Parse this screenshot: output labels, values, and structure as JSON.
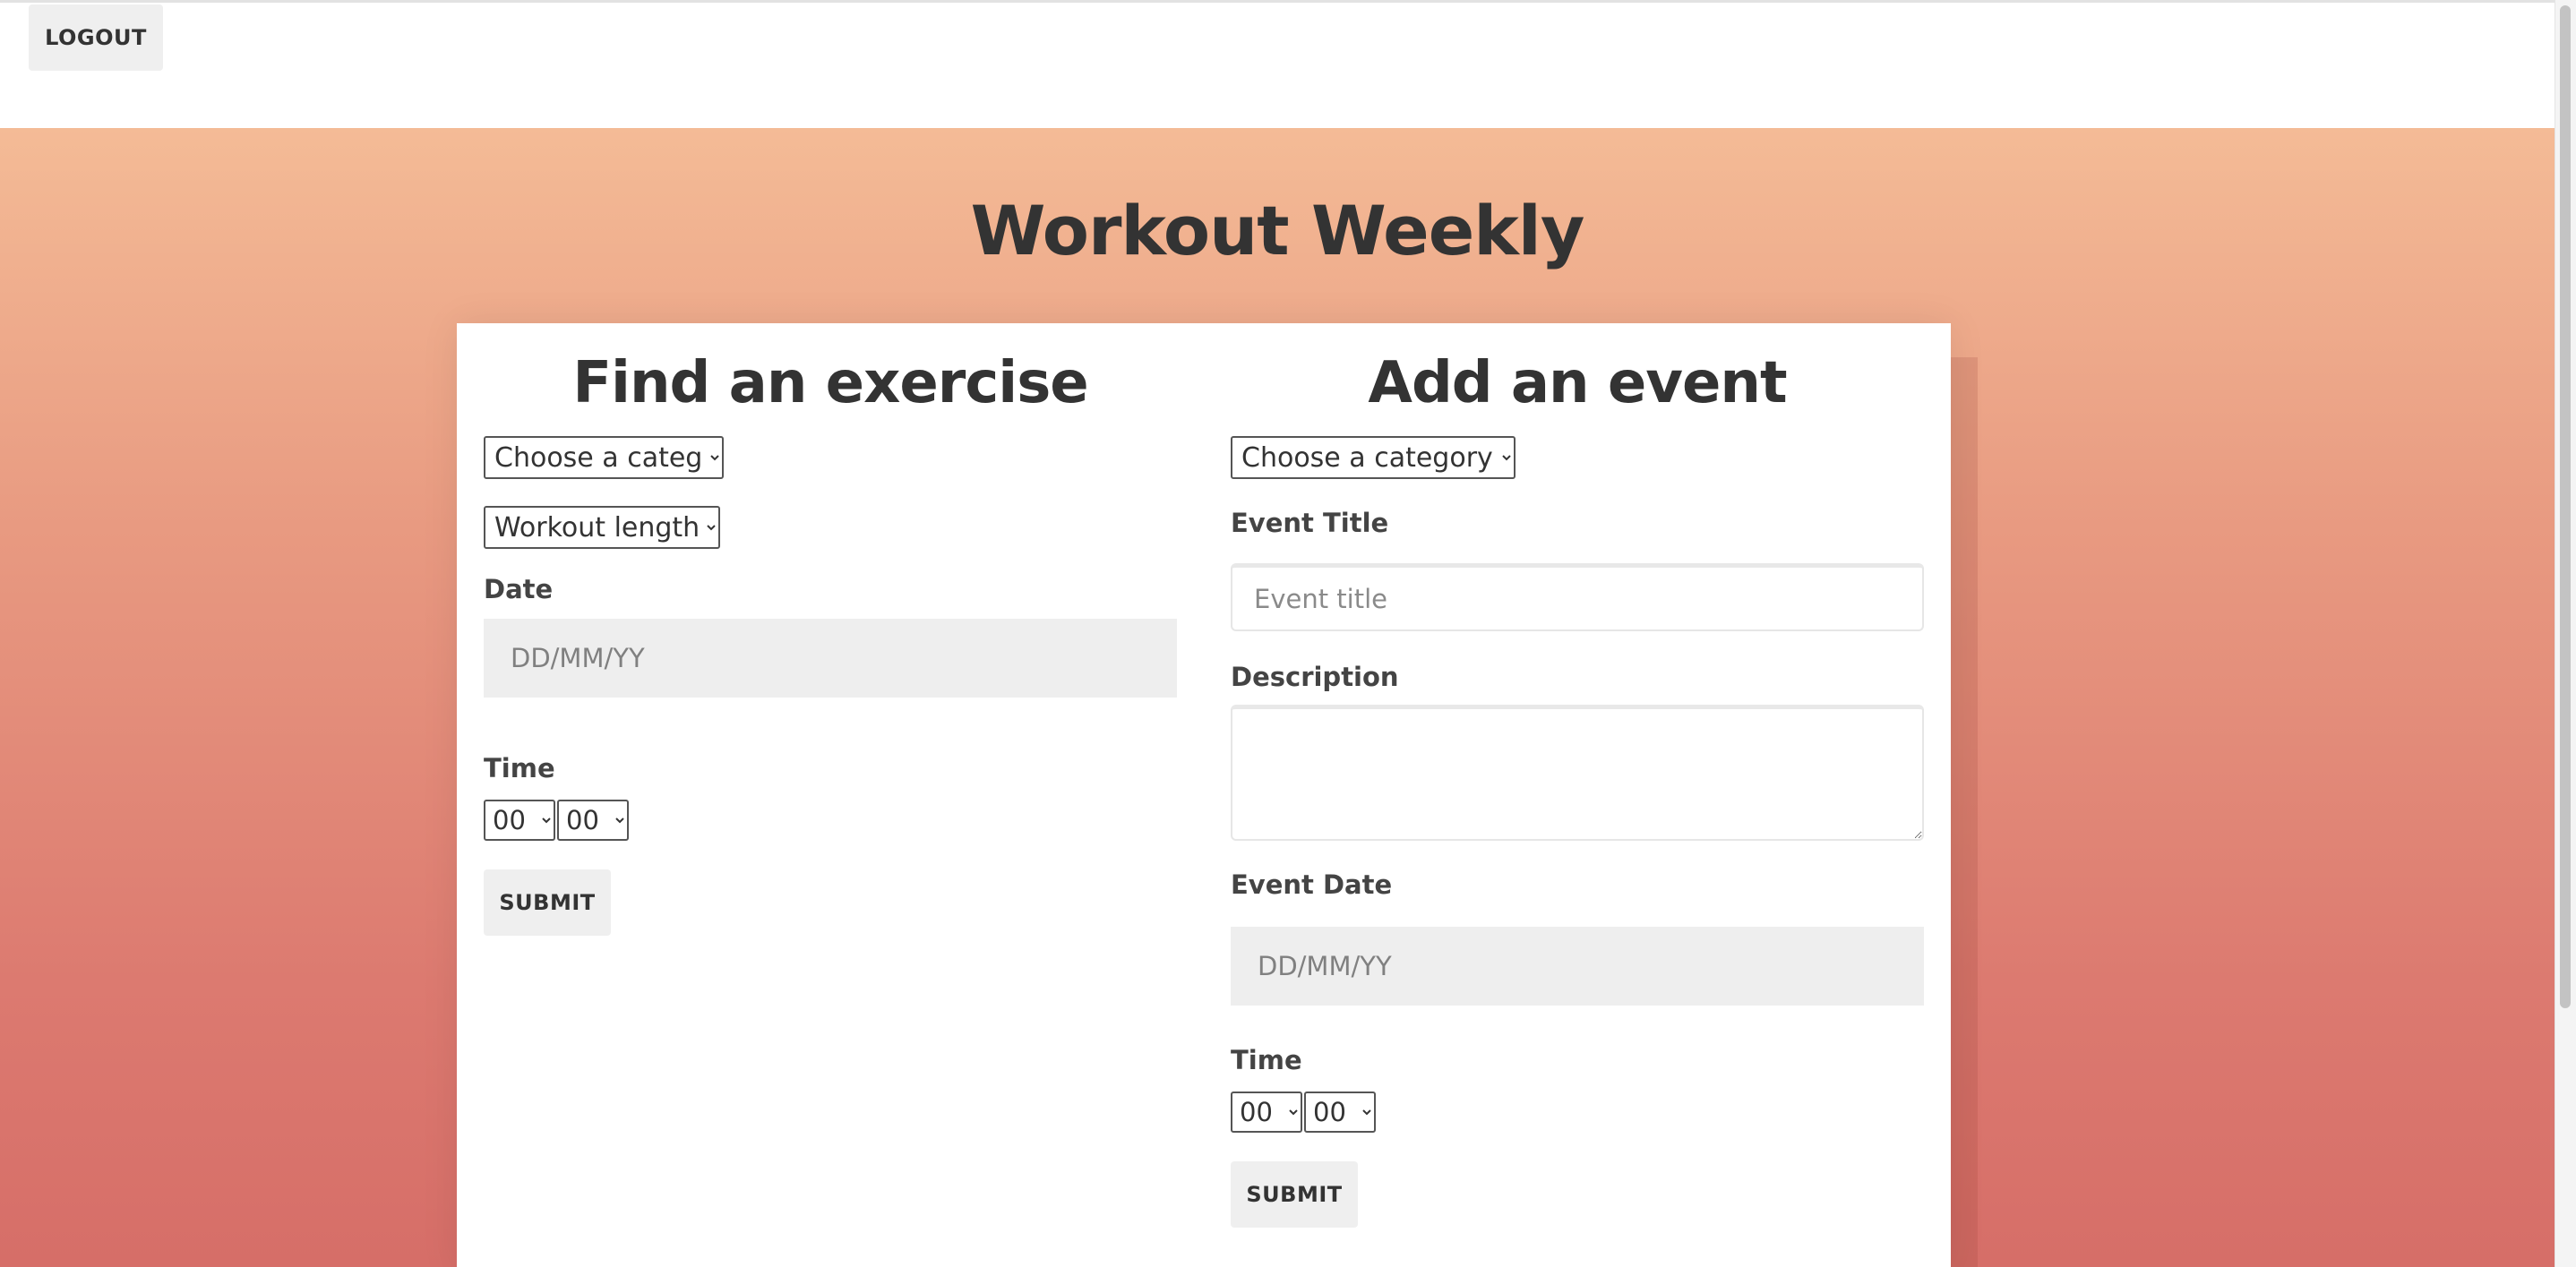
{
  "header": {
    "logout_label": "LOGOUT"
  },
  "page": {
    "title": "Workout Weekly"
  },
  "find_exercise": {
    "title": "Find an exercise",
    "category_select": "Choose a category:",
    "length_select": "Workout length:",
    "date_label": "Date",
    "date_placeholder": "DD/MM/YY",
    "time_label": "Time",
    "time_hour": "00",
    "time_minute": "00",
    "submit_label": "SUBMIT"
  },
  "add_event": {
    "title": "Add an event",
    "category_select": "Choose a category:",
    "event_title_label": "Event Title",
    "event_title_placeholder": "Event title",
    "description_label": "Description",
    "event_date_label": "Event Date",
    "event_date_placeholder": "DD/MM/YY",
    "time_label": "Time",
    "time_hour": "00",
    "time_minute": "00",
    "submit_label": "SUBMIT"
  },
  "colors": {
    "gradient_top": "#f4bb96",
    "gradient_bottom": "#d66e68",
    "text_dark": "#333333",
    "button_bg": "#efefef"
  }
}
